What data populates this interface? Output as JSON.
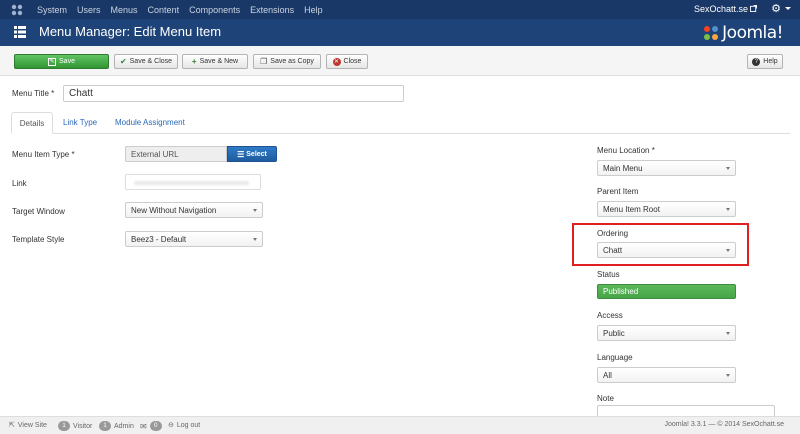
{
  "topnav": {
    "menu": [
      "System",
      "Users",
      "Menus",
      "Content",
      "Components",
      "Extensions",
      "Help"
    ],
    "site_name": "SexOchatt.se"
  },
  "header": {
    "title": "Menu Manager: Edit Menu Item",
    "brand": "Joomla!"
  },
  "toolbar": {
    "save": "Save",
    "save_close": "Save & Close",
    "save_new": "Save & New",
    "save_copy": "Save as Copy",
    "close": "Close",
    "help": "Help"
  },
  "form": {
    "menu_title_label": "Menu Title *",
    "menu_title_value": "Chatt",
    "tabs": [
      "Details",
      "Link Type",
      "Module Assignment"
    ],
    "menu_item_type_label": "Menu Item Type *",
    "menu_item_type_value": "External URL",
    "select_label": "Select",
    "link_label": "Link",
    "target_window_label": "Target Window",
    "target_window_value": "New Without Navigation",
    "template_style_label": "Template Style",
    "template_style_value": "Beez3 - Default"
  },
  "sidebar": {
    "menu_location_label": "Menu Location *",
    "menu_location_value": "Main Menu",
    "parent_item_label": "Parent Item",
    "parent_item_value": "Menu Item Root",
    "ordering_label": "Ordering",
    "ordering_value": "Chatt",
    "status_label": "Status",
    "status_value": "Published",
    "access_label": "Access",
    "access_value": "Public",
    "language_label": "Language",
    "language_value": "All",
    "note_label": "Note"
  },
  "footer": {
    "view_site": "View Site",
    "visitor_count": "1",
    "visitor_label": "Visitor",
    "admin_count": "1",
    "admin_label": "Admin",
    "messages_count": "0",
    "logout": "Log out",
    "version_text": "Joomla! 3.3.1  —  © 2014 SexOchatt.se"
  },
  "colors": {
    "topnav_bg": "#1a3867",
    "header_bg": "#1d4378",
    "save_green": "#46a546",
    "select_blue": "#2f7ac7",
    "highlight_red": "#e02020"
  }
}
